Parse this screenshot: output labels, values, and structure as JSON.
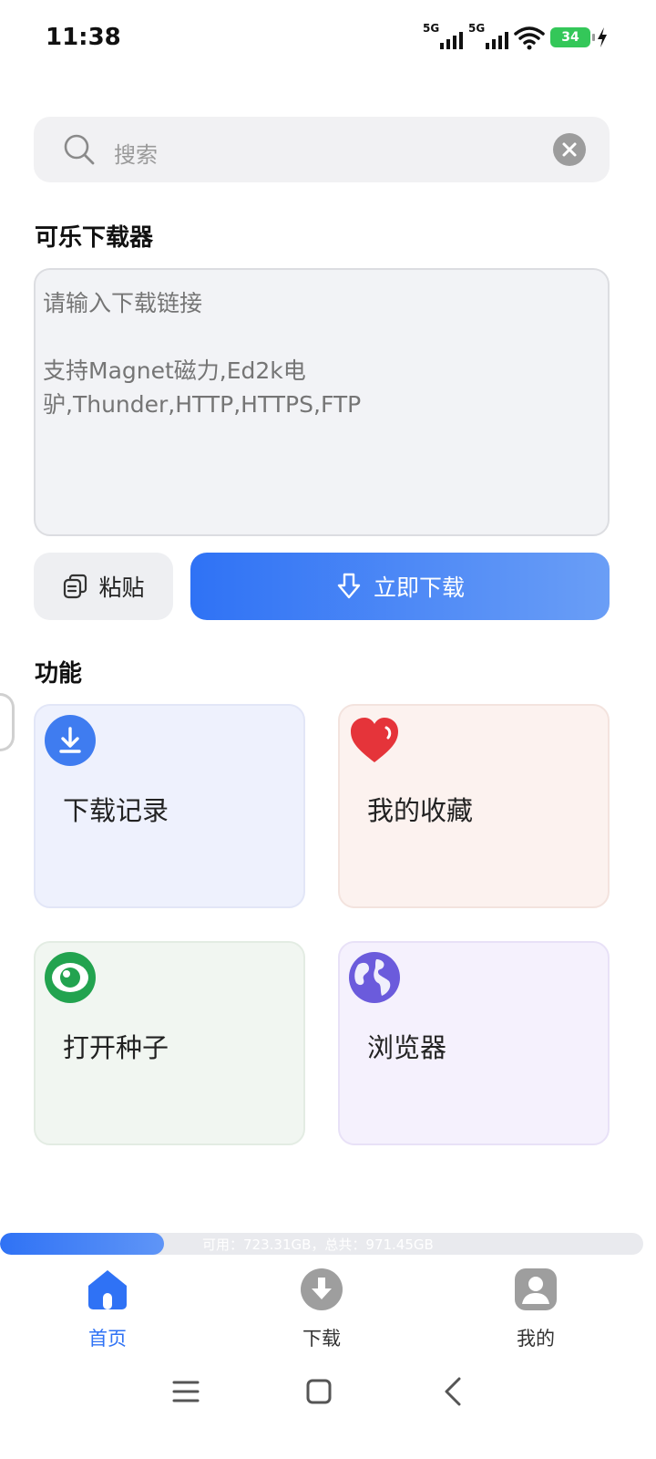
{
  "status_bar": {
    "time": "11:38",
    "network_1": "5G",
    "network_2": "5G",
    "battery": "34",
    "icons": [
      "signal-icon",
      "signal-icon",
      "wifi-icon",
      "battery-icon",
      "charging-icon"
    ]
  },
  "search": {
    "placeholder": "搜索"
  },
  "downloader": {
    "title": "可乐下载器",
    "input_placeholder": "请输入下载链接\n\n支持Magnet磁力,Ed2k电驴,Thunder,HTTP,HTTPS,FTP",
    "input_value": "",
    "paste_label": "粘贴",
    "download_label": "立即下载"
  },
  "features": {
    "title": "功能",
    "cards": [
      {
        "label": "下载记录",
        "icon": "download-icon",
        "color": "#3f7cf0"
      },
      {
        "label": "我的收藏",
        "icon": "heart-icon",
        "color": "#e5343a"
      },
      {
        "label": "打开种子",
        "icon": "eye-icon",
        "color": "#22a34f"
      },
      {
        "label": "浏览器",
        "icon": "globe-icon",
        "color": "#6b5bdc"
      }
    ]
  },
  "storage": {
    "text": "可用：723.31GB，总共：971.45GB",
    "used_fraction": 0.255
  },
  "bottom_nav": {
    "items": [
      {
        "label": "首页",
        "icon": "home-icon",
        "active": true
      },
      {
        "label": "下载",
        "icon": "download-circle-icon",
        "active": false
      },
      {
        "label": "我的",
        "icon": "profile-icon",
        "active": false
      }
    ]
  },
  "colors": {
    "accent": "#2f72f5",
    "accent_light": "#6a9ef6"
  }
}
